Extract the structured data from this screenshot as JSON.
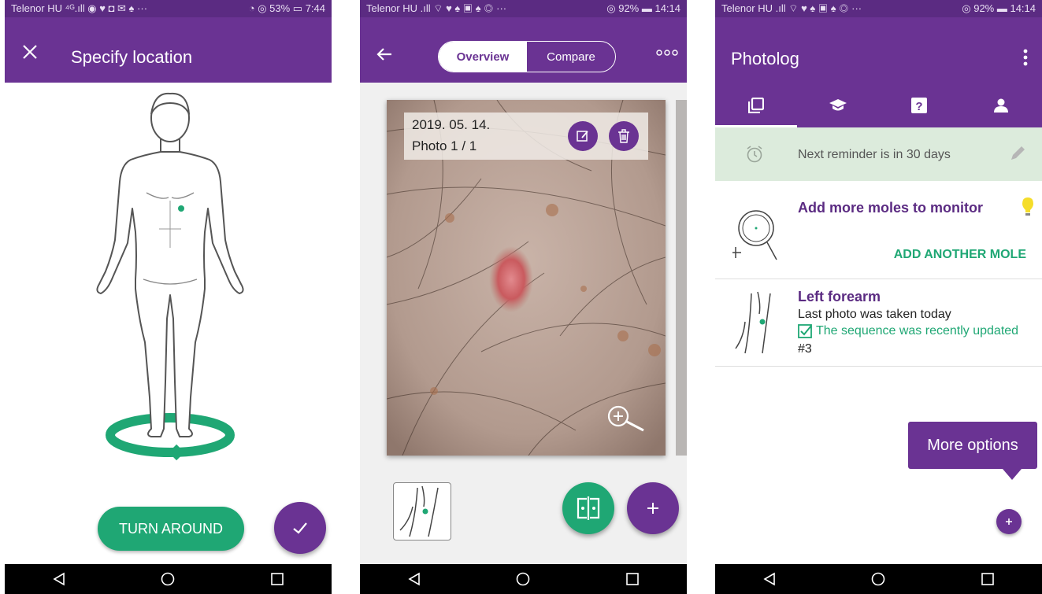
{
  "screen1": {
    "status": {
      "left": "Telenor HU ⁴ᴳ.ıll ◉ ♥ ◘ ✉ ♠ ···",
      "right": "◔ ◎ 53% ▭ 7:44"
    },
    "title": "Specify location",
    "turn_button": "TURN AROUND"
  },
  "screen2": {
    "status": {
      "left": "Telenor HU .ıll ⌔ ♥ ♠ ▣ ♠ ◎ ···",
      "right": "◎ 92% ▬ 14:14"
    },
    "tabs": [
      "Overview",
      "Compare"
    ],
    "photo_date": "2019. 05. 14.",
    "photo_count": "Photo 1 / 1"
  },
  "screen3": {
    "status": {
      "left": "Telenor HU .ıll ⌔ ♥ ♠ ▣ ♠ ◎ ···",
      "right": "◎ 92% ▬ 14:14"
    },
    "title": "Photolog",
    "reminder": "Next reminder is in 30 days",
    "tip_title": "Add more moles to monitor",
    "tip_action": "ADD ANOTHER MOLE",
    "mole_name": "Left forearm",
    "mole_last_photo": "Last photo was taken today",
    "mole_updated": "The sequence was recently updated",
    "mole_number": "#3",
    "tooltip": "More options"
  },
  "colors": {
    "brand_purple": "#6a3393",
    "accent_green": "#1fa774",
    "reminder_bg": "#dcebdc"
  },
  "icons": [
    "close-icon",
    "check-icon",
    "back-arrow-icon",
    "more-dots-icon",
    "edit-icon",
    "trash-icon",
    "zoom-icon",
    "compare-icon",
    "plus-icon",
    "photos-tab-icon",
    "learn-tab-icon",
    "help-tab-icon",
    "profile-tab-icon",
    "alarm-icon",
    "pencil-icon",
    "magnifier-icon",
    "lightbulb-icon",
    "checkbox-icon",
    "kebab-icon"
  ]
}
